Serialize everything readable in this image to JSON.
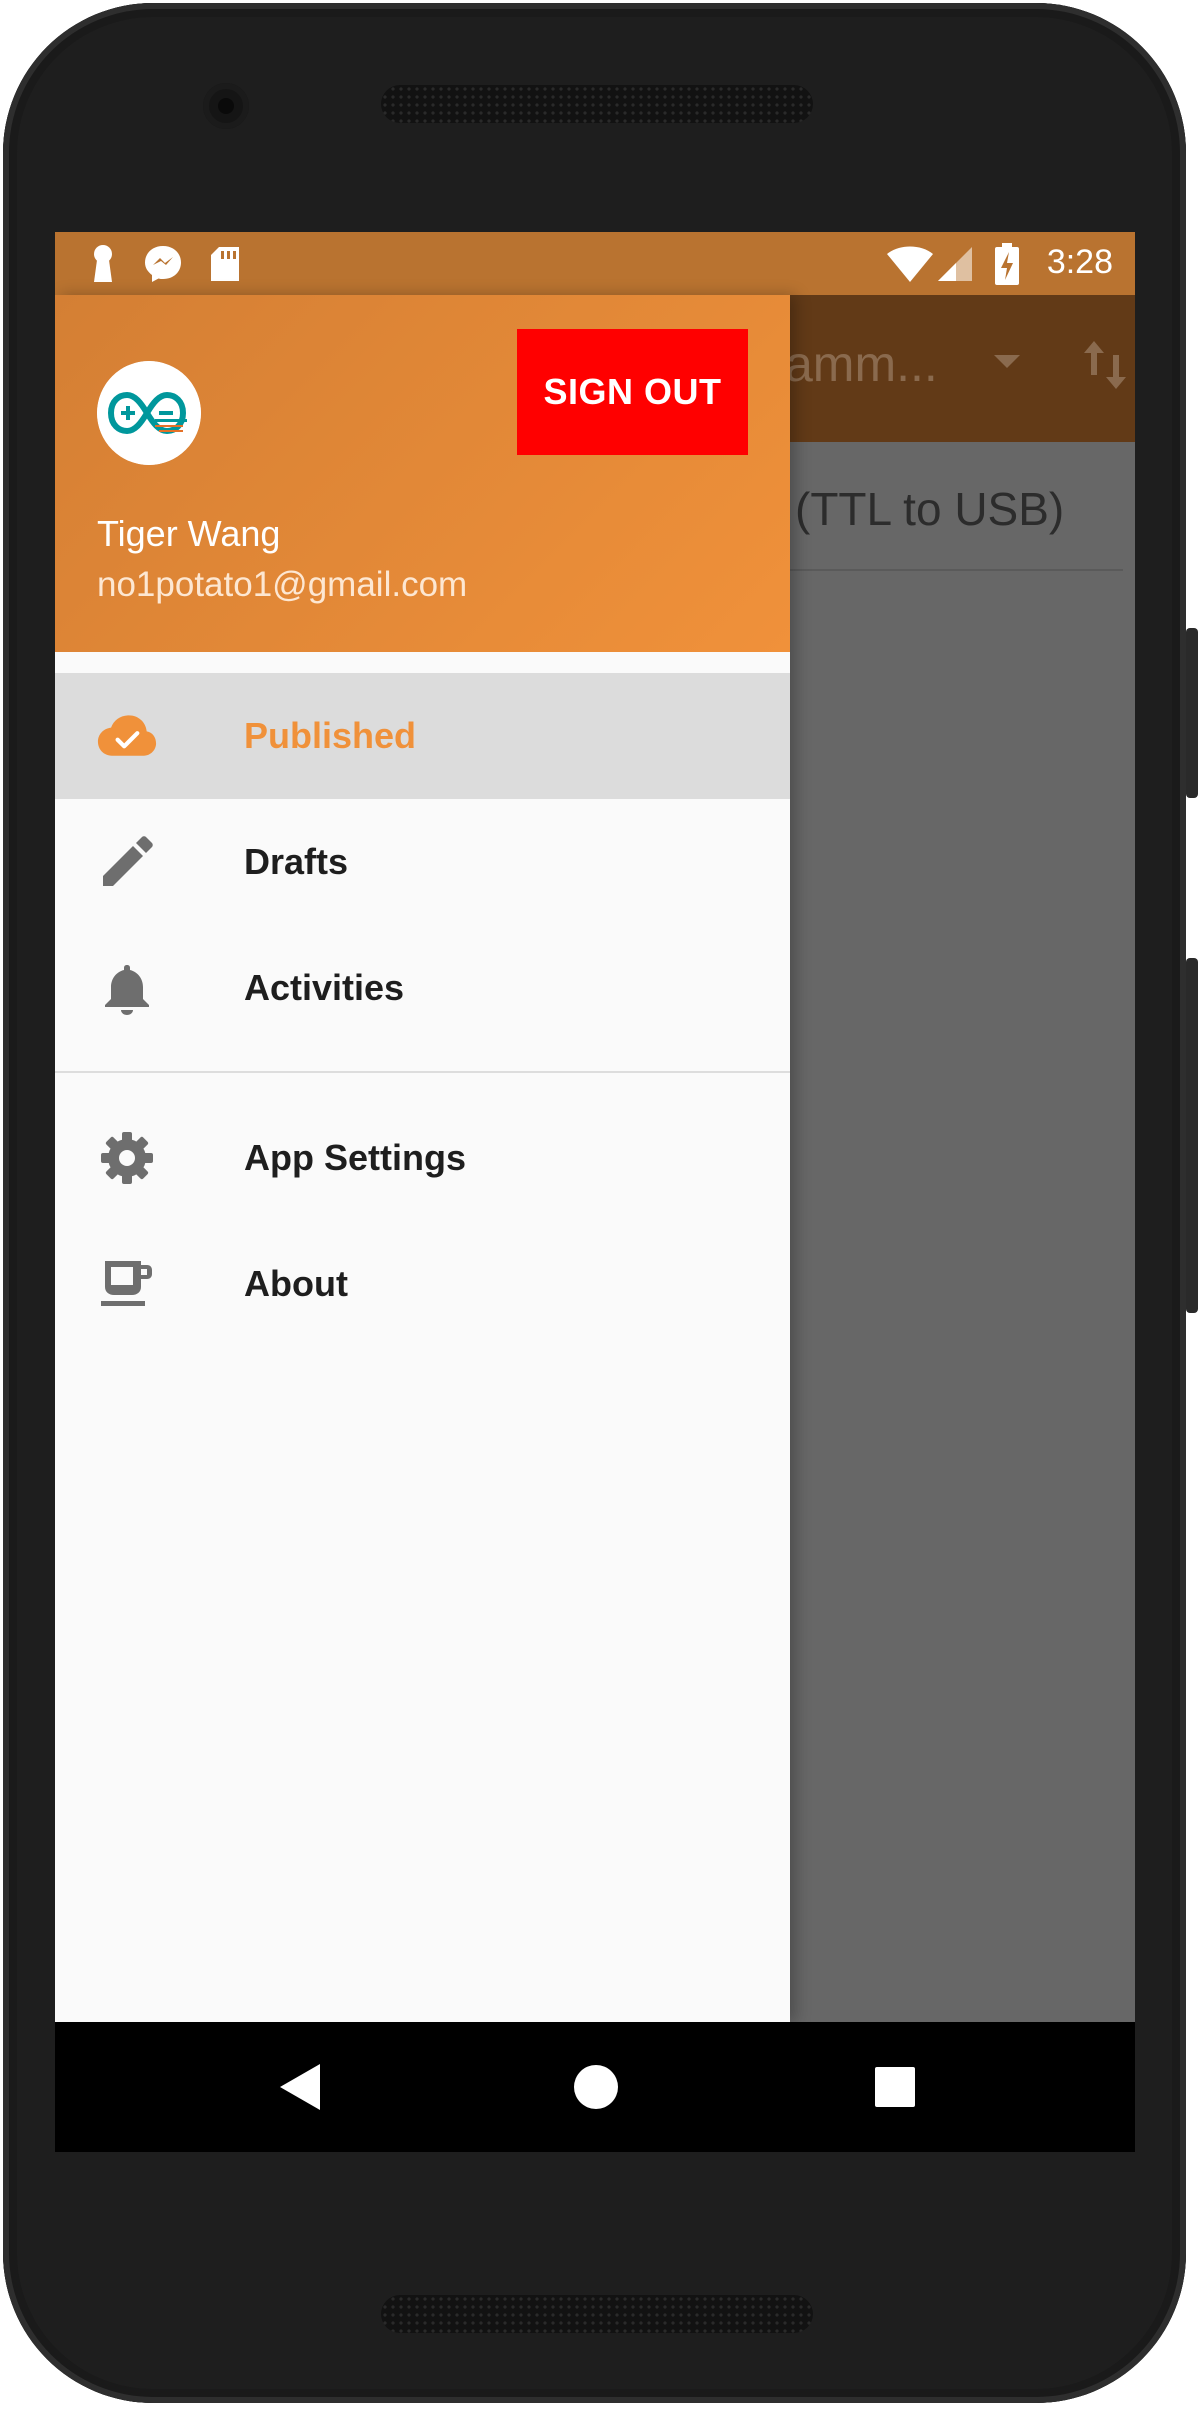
{
  "status_bar": {
    "time": "3:28",
    "left_icons": [
      "keyhole-icon",
      "messenger-icon",
      "sd-card-icon"
    ],
    "right_icons": [
      "wifi-icon",
      "signal-icon",
      "battery-charging-icon"
    ]
  },
  "background_app": {
    "toolbar_title": "amm...",
    "row_text": "(TTL to USB)",
    "fab_label": "+"
  },
  "drawer": {
    "header": {
      "avatar_icon": "arduino-logo",
      "sign_out_label": "SIGN OUT",
      "user_name": "Tiger Wang",
      "user_email": "no1potato1@gmail.com"
    },
    "items": [
      {
        "label": "Published",
        "icon": "cloud-done-icon",
        "selected": true
      },
      {
        "label": "Drafts",
        "icon": "pencil-icon",
        "selected": false
      },
      {
        "label": "Activities",
        "icon": "bell-icon",
        "selected": false
      },
      {
        "label": "App Settings",
        "icon": "gear-icon",
        "selected": false
      },
      {
        "label": "About",
        "icon": "coffee-icon",
        "selected": false
      }
    ]
  },
  "colors": {
    "accent": "#f0913a",
    "header_dark": "#d47f34",
    "sign_out": "#ff0000",
    "status_bar": "#b97330"
  }
}
